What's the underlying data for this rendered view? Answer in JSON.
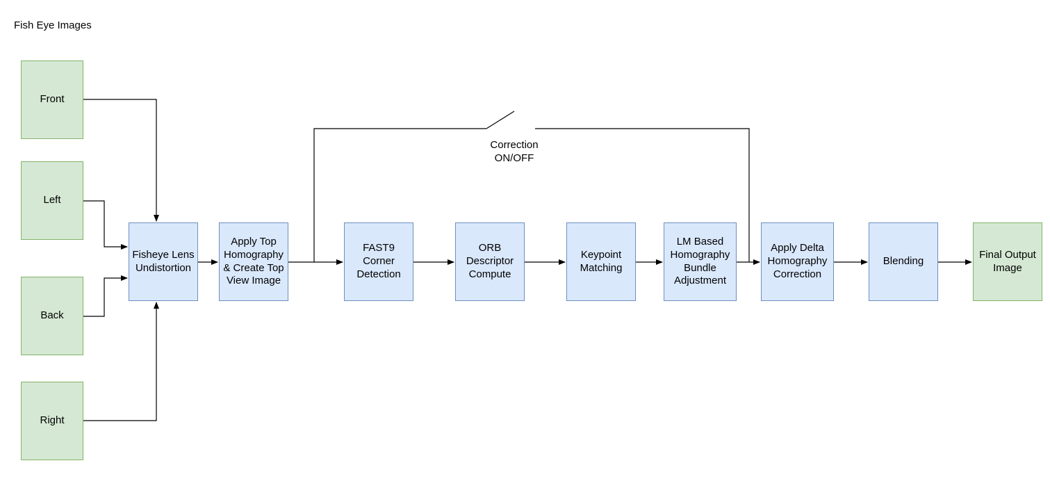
{
  "title": "Fish Eye Images",
  "inputs": {
    "front": "Front",
    "left": "Left",
    "back": "Back",
    "right": "Right"
  },
  "stages": {
    "undistort": "Fisheye Lens Undistortion",
    "topview": "Apply Top Homography & Create Top View Image",
    "fast9": "FAST9 Corner Detection",
    "orb": "ORB Descriptor Compute",
    "match": "Keypoint Matching",
    "lm": "LM Based Homography Bundle Adjustment",
    "delta": "Apply Delta Homography Correction",
    "blend": "Blending"
  },
  "output": "Final Output Image",
  "switch_label": "Correction\nON/OFF"
}
